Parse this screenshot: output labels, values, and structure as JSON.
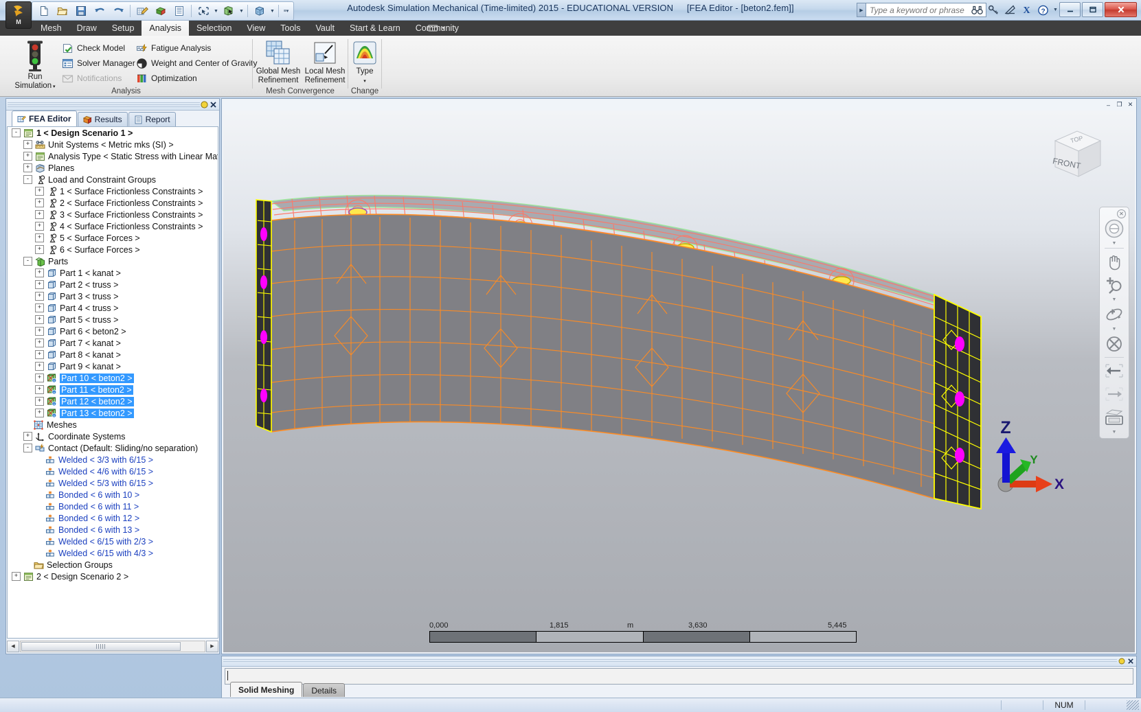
{
  "window": {
    "title": "Autodesk Simulation Mechanical (Time-limited) 2015 - EDUCATIONAL VERSION",
    "document_title": "[FEA Editor - [beton2.fem]]",
    "app_button_letter": "M",
    "minimize_label": "–",
    "maximize_label": "❐",
    "close_label": "✕"
  },
  "quick_access": {
    "items": [
      {
        "name": "new-file-icon",
        "title": "New"
      },
      {
        "name": "open-file-icon",
        "title": "Open"
      },
      {
        "name": "save-icon",
        "title": "Save"
      },
      {
        "name": "undo-icon",
        "title": "Undo"
      },
      {
        "name": "redo-icon",
        "title": "Redo"
      },
      {
        "name": "edit-mesh-icon",
        "title": "Edit Mesh"
      },
      {
        "name": "part-color-icon",
        "title": "Part Color"
      },
      {
        "name": "list-icon",
        "title": "List"
      },
      {
        "name": "selection-rect-icon",
        "title": "Selection Rectangle"
      },
      {
        "name": "select-part-icon",
        "title": "Select Part"
      },
      {
        "name": "view-cube-icon",
        "title": "Visual Style"
      }
    ]
  },
  "search": {
    "placeholder": "Type a keyword or phrase",
    "icons": [
      {
        "name": "binoculars-icon"
      },
      {
        "name": "key-icon"
      },
      {
        "name": "satellite-dish-icon"
      },
      {
        "name": "exchange-x-icon"
      },
      {
        "name": "help-icon"
      }
    ]
  },
  "menu": {
    "tabs": [
      {
        "label": "Mesh",
        "active": false
      },
      {
        "label": "Draw",
        "active": false
      },
      {
        "label": "Setup",
        "active": false
      },
      {
        "label": "Analysis",
        "active": true
      },
      {
        "label": "Selection",
        "active": false
      },
      {
        "label": "View",
        "active": false
      },
      {
        "label": "Tools",
        "active": false
      },
      {
        "label": "Vault",
        "active": false
      },
      {
        "label": "Start & Learn",
        "active": false
      },
      {
        "label": "Community",
        "active": false
      }
    ]
  },
  "ribbon": {
    "panels": [
      {
        "title": "Analysis",
        "big_button": {
          "label_line1": "Run",
          "label_line2": "Simulation",
          "icon": "traffic-light-icon"
        },
        "items": [
          {
            "label": "Check Model",
            "icon": "check-model-icon",
            "disabled": false
          },
          {
            "label": "Fatigue Analysis",
            "icon": "fatigue-analysis-icon",
            "disabled": false
          },
          {
            "label": "Solver Manager",
            "icon": "solver-manager-icon",
            "disabled": false
          },
          {
            "label": "Weight and Center of Gravity",
            "icon": "weight-cog-icon",
            "disabled": false
          },
          {
            "label": "Notifications",
            "icon": "notifications-icon",
            "disabled": true
          },
          {
            "label": "Optimization",
            "icon": "optimization-icon",
            "disabled": false
          }
        ]
      },
      {
        "title": "Mesh Convergence",
        "buttons": [
          {
            "label_line1": "Global Mesh",
            "label_line2": "Refinement",
            "icon": "global-mesh-refinement-icon"
          },
          {
            "label_line1": "Local Mesh",
            "label_line2": "Refinement",
            "icon": "local-mesh-refinement-icon"
          }
        ]
      },
      {
        "title": "Change",
        "buttons": [
          {
            "label_line1": "Type",
            "label_line2": "",
            "icon": "analysis-type-icon"
          }
        ]
      }
    ]
  },
  "tree_panel": {
    "tabs": [
      {
        "label": "FEA Editor",
        "icon": "fea-editor-icon",
        "active": true
      },
      {
        "label": "Results",
        "icon": "results-icon",
        "active": false
      },
      {
        "label": "Report",
        "icon": "report-icon",
        "active": false
      }
    ],
    "nodes": [
      {
        "label": "1 < Design Scenario 1 >",
        "indent": 0,
        "toggle": "-",
        "icon": "design-scenario-icon",
        "style": "bold"
      },
      {
        "label": "Unit Systems < Metric mks (SI) >",
        "indent": 1,
        "toggle": "+",
        "icon": "unit-systems-icon",
        "style": ""
      },
      {
        "label": "Analysis Type < Static Stress with Linear Mater",
        "indent": 1,
        "toggle": "+",
        "icon": "analysis-type-tree-icon",
        "style": ""
      },
      {
        "label": "Planes",
        "indent": 1,
        "toggle": "+",
        "icon": "planes-icon",
        "style": ""
      },
      {
        "label": "Load and Constraint Groups",
        "indent": 1,
        "toggle": "-",
        "icon": "load-constraint-icon",
        "style": ""
      },
      {
        "label": "1 < Surface Frictionless Constraints >",
        "indent": 2,
        "toggle": "+",
        "icon": "load-constraint-icon",
        "style": ""
      },
      {
        "label": "2 < Surface Frictionless Constraints >",
        "indent": 2,
        "toggle": "+",
        "icon": "load-constraint-icon",
        "style": ""
      },
      {
        "label": "3 < Surface Frictionless Constraints >",
        "indent": 2,
        "toggle": "+",
        "icon": "load-constraint-icon",
        "style": ""
      },
      {
        "label": "4 < Surface Frictionless Constraints >",
        "indent": 2,
        "toggle": "+",
        "icon": "load-constraint-icon",
        "style": ""
      },
      {
        "label": "5 < Surface Forces >",
        "indent": 2,
        "toggle": "+",
        "icon": "load-constraint-icon",
        "style": ""
      },
      {
        "label": "6 < Surface Forces >",
        "indent": 2,
        "toggle": "+",
        "icon": "load-constraint-icon",
        "style": ""
      },
      {
        "label": "Parts",
        "indent": 1,
        "toggle": "-",
        "icon": "parts-icon",
        "style": ""
      },
      {
        "label": "Part 1 < kanat >",
        "indent": 2,
        "toggle": "+",
        "icon": "part-icon",
        "style": ""
      },
      {
        "label": "Part 2 < truss >",
        "indent": 2,
        "toggle": "+",
        "icon": "part-icon",
        "style": ""
      },
      {
        "label": "Part 3 < truss >",
        "indent": 2,
        "toggle": "+",
        "icon": "part-icon",
        "style": ""
      },
      {
        "label": "Part 4 < truss >",
        "indent": 2,
        "toggle": "+",
        "icon": "part-icon",
        "style": ""
      },
      {
        "label": "Part 5 < truss >",
        "indent": 2,
        "toggle": "+",
        "icon": "part-icon",
        "style": ""
      },
      {
        "label": "Part 6 < beton2 >",
        "indent": 2,
        "toggle": "+",
        "icon": "part-icon",
        "style": ""
      },
      {
        "label": "Part 7 < kanat >",
        "indent": 2,
        "toggle": "+",
        "icon": "part-icon",
        "style": ""
      },
      {
        "label": "Part 8 < kanat >",
        "indent": 2,
        "toggle": "+",
        "icon": "part-icon",
        "style": ""
      },
      {
        "label": "Part 9 < kanat >",
        "indent": 2,
        "toggle": "+",
        "icon": "part-icon",
        "style": ""
      },
      {
        "label": "Part 10 < beton2 >",
        "indent": 2,
        "toggle": "+",
        "icon": "part-meshed-icon",
        "style": "sel"
      },
      {
        "label": "Part 11 < beton2 >",
        "indent": 2,
        "toggle": "+",
        "icon": "part-meshed-icon",
        "style": "sel"
      },
      {
        "label": "Part 12 < beton2 >",
        "indent": 2,
        "toggle": "+",
        "icon": "part-meshed-icon",
        "style": "sel"
      },
      {
        "label": "Part 13 < beton2 >",
        "indent": 2,
        "toggle": "+",
        "icon": "part-meshed-icon",
        "style": "sel"
      },
      {
        "label": "Meshes",
        "indent": 1,
        "toggle": "",
        "icon": "meshes-icon",
        "style": ""
      },
      {
        "label": "Coordinate Systems",
        "indent": 1,
        "toggle": "+",
        "icon": "coordinate-systems-icon",
        "style": ""
      },
      {
        "label": "Contact (Default: Sliding/no separation)",
        "indent": 1,
        "toggle": "-",
        "icon": "contact-icon",
        "style": ""
      },
      {
        "label": "Welded < 3/3 with 6/15 >",
        "indent": 2,
        "toggle": "",
        "icon": "contact-pair-icon",
        "style": "blue"
      },
      {
        "label": "Welded < 4/6 with 6/15 >",
        "indent": 2,
        "toggle": "",
        "icon": "contact-pair-icon",
        "style": "blue"
      },
      {
        "label": "Welded < 5/3 with 6/15 >",
        "indent": 2,
        "toggle": "",
        "icon": "contact-pair-icon",
        "style": "blue"
      },
      {
        "label": "Bonded < 6 with 10 >",
        "indent": 2,
        "toggle": "",
        "icon": "contact-pair-icon",
        "style": "blue"
      },
      {
        "label": "Bonded < 6 with 11 >",
        "indent": 2,
        "toggle": "",
        "icon": "contact-pair-icon",
        "style": "blue"
      },
      {
        "label": "Bonded < 6 with 12 >",
        "indent": 2,
        "toggle": "",
        "icon": "contact-pair-icon",
        "style": "blue"
      },
      {
        "label": "Bonded < 6 with 13 >",
        "indent": 2,
        "toggle": "",
        "icon": "contact-pair-icon",
        "style": "blue"
      },
      {
        "label": "Welded < 6/15 with 2/3 >",
        "indent": 2,
        "toggle": "",
        "icon": "contact-pair-icon",
        "style": "blue"
      },
      {
        "label": "Welded < 6/15 with 4/3 >",
        "indent": 2,
        "toggle": "",
        "icon": "contact-pair-icon",
        "style": "blue"
      },
      {
        "label": "Selection Groups",
        "indent": 1,
        "toggle": "",
        "icon": "selection-groups-icon",
        "style": ""
      },
      {
        "label": "2 < Design Scenario 2 >",
        "indent": 0,
        "toggle": "+",
        "icon": "design-scenario-icon",
        "style": ""
      }
    ]
  },
  "viewport": {
    "view_cube": {
      "top_face": "TOP",
      "front_face": "FRONT"
    },
    "nav_tools": [
      {
        "name": "steering-wheel-icon"
      },
      {
        "name": "pan-hand-icon"
      },
      {
        "name": "zoom-icon"
      },
      {
        "name": "orbit-icon"
      },
      {
        "name": "center-icon"
      },
      {
        "name": "back-arrow-icon"
      },
      {
        "name": "forward-arrow-icon"
      },
      {
        "name": "rectangle-window-icon"
      }
    ],
    "scale_bar": {
      "labels": [
        "0,000",
        "1,815",
        "3,630",
        "5,445"
      ],
      "unit": "m"
    },
    "axis_triad": {
      "x": "X",
      "y": "Y",
      "z": "Z",
      "x_color": "#dd3b14",
      "y_color": "#1ea31e",
      "z_color": "#1414d2"
    },
    "window_buttons": {
      "minimize": "–",
      "restore": "❐",
      "close": "✕"
    },
    "mesh_colors": {
      "top_face": "#a9aab0",
      "front_face": "#808085",
      "top_wire": "#ff7766",
      "front_wire": "#ff8c22",
      "edge_mesh": "#ffff00",
      "marker": "#ff00ff",
      "highlight": "#ffe84d"
    }
  },
  "bottom_panel": {
    "tabs": [
      {
        "label": "Solid Meshing",
        "active": true
      },
      {
        "label": "Details",
        "active": false
      }
    ]
  },
  "status_bar": {
    "message": "",
    "indicators": [
      "",
      "NUM",
      ""
    ]
  }
}
